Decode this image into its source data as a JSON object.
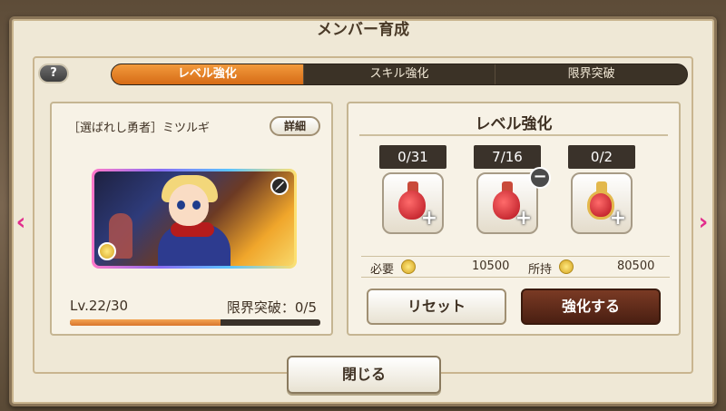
{
  "dialog": {
    "title": "メンバー育成"
  },
  "help": {
    "label": "?"
  },
  "tabs": [
    {
      "label": "レベル強化",
      "active": true
    },
    {
      "label": "スキル強化",
      "active": false
    },
    {
      "label": "限界突破",
      "active": false
    }
  ],
  "character": {
    "name": "［選ばれし勇者］ミツルギ",
    "detail_label": "詳細",
    "level_text": "Lv.22/30",
    "limit_break_text": "限界突破：0/5",
    "xp_progress": 0.6
  },
  "enhance": {
    "title": "レベル強化",
    "potions": [
      {
        "count": "0/31",
        "type": "small-potion"
      },
      {
        "count": "7/16",
        "type": "medium-potion"
      },
      {
        "count": "0/2",
        "type": "large-potion"
      }
    ],
    "cost_label": "必要",
    "cost_value": "10500",
    "owned_label": "所持",
    "owned_value": "80500",
    "reset_label": "リセット",
    "enhance_label": "強化する"
  },
  "close_label": "閉じる",
  "nav": {
    "prev": "‹",
    "next": "›"
  },
  "colors": {
    "accent": "#e07a22",
    "dark_button": "#5a2717",
    "arrow": "#e22d8c"
  }
}
